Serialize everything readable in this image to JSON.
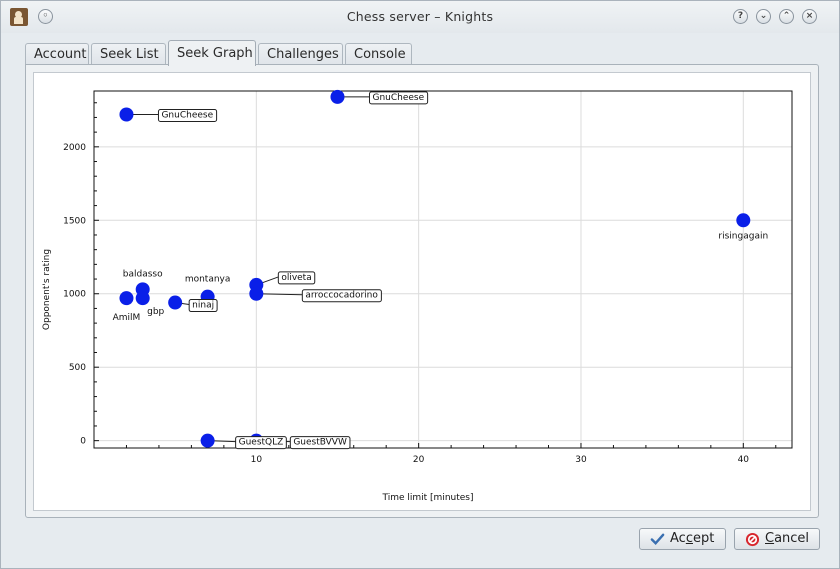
{
  "window": {
    "title": "Chess server – Knights",
    "app_icon": "knight-icon",
    "controls": [
      "help-icon",
      "minimize-icon",
      "maximize-icon"
    ]
  },
  "tabs": [
    {
      "label": "Account",
      "active": false
    },
    {
      "label": "Seek List",
      "active": false
    },
    {
      "label": "Seek Graph",
      "active": true
    },
    {
      "label": "Challenges",
      "active": false
    },
    {
      "label": "Console",
      "active": false
    }
  ],
  "chart_data": {
    "type": "scatter",
    "xlabel": "Time limit [minutes]",
    "ylabel": "Opponent's rating",
    "xlim": [
      0,
      43
    ],
    "ylim": [
      -50,
      2380
    ],
    "xticks": [
      10,
      20,
      30,
      40
    ],
    "yticks": [
      0,
      500,
      1000,
      1500,
      2000
    ],
    "grid": true,
    "point_color": "#0a1fe8",
    "points": [
      {
        "label": "GnuCheese",
        "x": 2,
        "y": 2220,
        "boxed": true
      },
      {
        "label": "GnuCheese",
        "x": 15,
        "y": 2340,
        "boxed": true
      },
      {
        "label": "risingagain",
        "x": 40,
        "y": 1500,
        "boxed": false
      },
      {
        "label": "baldasso",
        "x": 3,
        "y": 1030,
        "boxed": false
      },
      {
        "label": "AmilM",
        "x": 2,
        "y": 970,
        "boxed": false
      },
      {
        "label": "gbp",
        "x": 3,
        "y": 970,
        "boxed": false
      },
      {
        "label": "ninaj",
        "x": 5,
        "y": 940,
        "boxed": true
      },
      {
        "label": "montanya",
        "x": 7,
        "y": 980,
        "boxed": false
      },
      {
        "label": "oliveta",
        "x": 10,
        "y": 1060,
        "boxed": true
      },
      {
        "label": "arroccocadorino",
        "x": 10,
        "y": 1000,
        "boxed": true
      },
      {
        "label": "GuestQLZ",
        "x": 7,
        "y": 0,
        "boxed": true
      },
      {
        "label": "GuestBVVW",
        "x": 10,
        "y": 0,
        "boxed": true
      }
    ]
  },
  "buttons": {
    "accept": {
      "label_pre": "Ac",
      "label_u": "c",
      "label_post": "ept",
      "icon": "check-icon"
    },
    "cancel": {
      "label_pre": "",
      "label_u": "C",
      "label_post": "ancel",
      "icon": "cancel-icon"
    }
  }
}
